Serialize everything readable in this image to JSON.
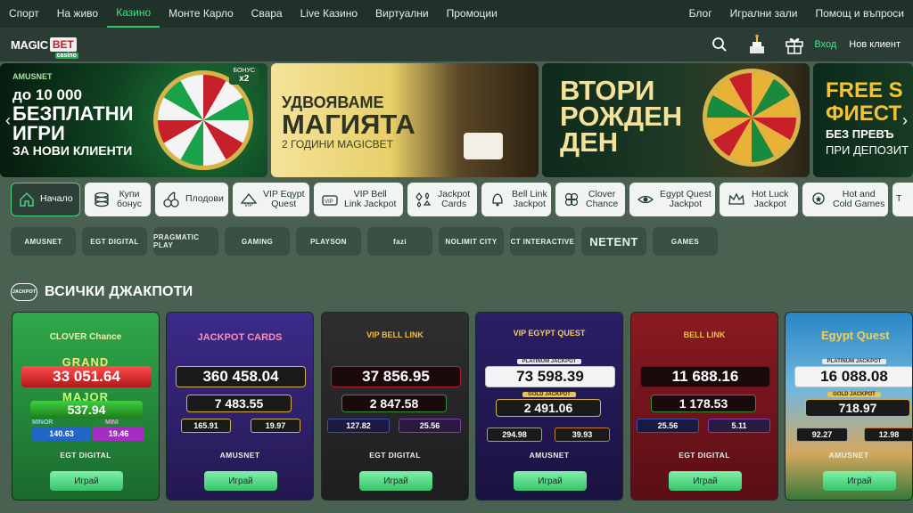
{
  "topnav": {
    "items": [
      "Спорт",
      "На живо",
      "Казино",
      "Монте Карло",
      "Свара",
      "Live Казино",
      "Виртуални",
      "Промоции"
    ],
    "active_index": 2,
    "right": [
      "Блог",
      "Игрални зали",
      "Помощ и въпроси"
    ]
  },
  "header": {
    "logo_magic": "MAGIC",
    "logo_bet": "BET",
    "logo_casino": "casino",
    "login": "Вход",
    "register": "Нов клиент"
  },
  "banners": [
    {
      "provider": "AMUSNET",
      "bonus": "БОНУС",
      "bonus_x": "x2",
      "line1": "до 10 000",
      "line2": "БЕЗПЛАТНИ",
      "line3": "ИГРИ",
      "line4": "ЗА НОВИ КЛИЕНТИ"
    },
    {
      "line1": "УДВОЯВАМЕ",
      "line2": "МАГИЯТА",
      "line3": "2 ГОДИНИ MAGICBET"
    },
    {
      "line1": "ВТОРИ",
      "line2": "РОЖДЕН",
      "line3": "ДЕН"
    },
    {
      "line1": "FREE S",
      "line2": "ФИЕСТ",
      "line3": "БЕЗ ПРЕВЪ",
      "line4": "ПРИ ДЕПОЗИТ"
    }
  ],
  "categories": [
    {
      "label": "Начало",
      "icon": "home-icon"
    },
    {
      "label": "Купи\nбонус",
      "icon": "coins-icon"
    },
    {
      "label": "Плодови",
      "icon": "cherry-icon"
    },
    {
      "label": "VIP Eqypt\nQuest",
      "icon": "vip-egypt-icon"
    },
    {
      "label": "VIP Bell\nLink Jackpot",
      "icon": "vip-bell-icon"
    },
    {
      "label": "Jackpot\nCards",
      "icon": "cards-icon"
    },
    {
      "label": "Bell Link\nJackpot",
      "icon": "bell-icon"
    },
    {
      "label": "Clover\nChance",
      "icon": "clover-icon"
    },
    {
      "label": "Egypt Quest\nJackpot",
      "icon": "eye-icon"
    },
    {
      "label": "Hot Luck\nJackpot",
      "icon": "crown-icon"
    },
    {
      "label": "Hot and\nCold Games",
      "icon": "medal-icon"
    },
    {
      "label": "T",
      "icon": "more-icon"
    }
  ],
  "providers": [
    "AMUSNET",
    "EGT DIGITAL",
    "PRAGMATIC PLAY",
    "GAMING",
    "PLAYSON",
    "fazi",
    "NOLIMIT CITY",
    "CT INTERACTIVE",
    "NETENT",
    "GAMES"
  ],
  "section_title": "ВСИЧКИ ДЖАКПОТИ",
  "section_badge": "JACKPOT",
  "jackpots": [
    {
      "game": "CLOVER Chance",
      "provider": "EGT DIGITAL",
      "grand_label": "GRAND",
      "grand": "33 051.64",
      "major_label": "MAJOR",
      "major": "537.94",
      "minor_label": "MINOR",
      "minor": "140.63",
      "mini_label": "MINI",
      "mini": "19.46",
      "play": "Играй",
      "colors": {
        "bg": "#1f8a3a",
        "accent": "#d42a2a"
      }
    },
    {
      "game": "JACKPOT CARDS",
      "provider": "AMUSNET",
      "top": "360 458.04",
      "second": "7 483.55",
      "third": "165.91",
      "fourth": "19.97",
      "play": "Играй",
      "colors": {
        "bg": "#3b2b7a",
        "accent": "#c8a048"
      }
    },
    {
      "game": "VIP BELL LINK",
      "provider": "EGT DIGITAL",
      "top": "37 856.95",
      "second": "2 847.58",
      "third": "127.82",
      "fourth": "25.56",
      "play": "Играй",
      "colors": {
        "bg": "#2a2a2c",
        "accent": "#b02030"
      }
    },
    {
      "game": "VIP EGYPT QUEST",
      "provider": "AMUSNET",
      "plat_label": "PLATINUM JACKPOT",
      "top": "73 598.39",
      "gold_label": "GOLD JACKPOT",
      "second": "2 491.06",
      "third": "294.98",
      "fourth": "39.93",
      "play": "Играй",
      "colors": {
        "bg": "#2a1c5e",
        "accent": "#d4b050"
      }
    },
    {
      "game": "BELL LINK",
      "provider": "EGT DIGITAL",
      "top": "11 688.16",
      "second": "1 178.53",
      "third": "25.56",
      "fourth": "5.11",
      "play": "Играй",
      "colors": {
        "bg": "#7a1420",
        "accent": "#b01f2d"
      }
    },
    {
      "game": "Egypt Quest",
      "provider": "AMUSNET",
      "plat_label": "PLATINUM JACKPOT",
      "top": "16 088.08",
      "gold_label": "GOLD JACKPOT",
      "second": "718.97",
      "third": "92.27",
      "fourth": "12.98",
      "play": "Играй",
      "colors": {
        "bg": "#1c6e9e",
        "accent": "#d4b050"
      }
    }
  ]
}
